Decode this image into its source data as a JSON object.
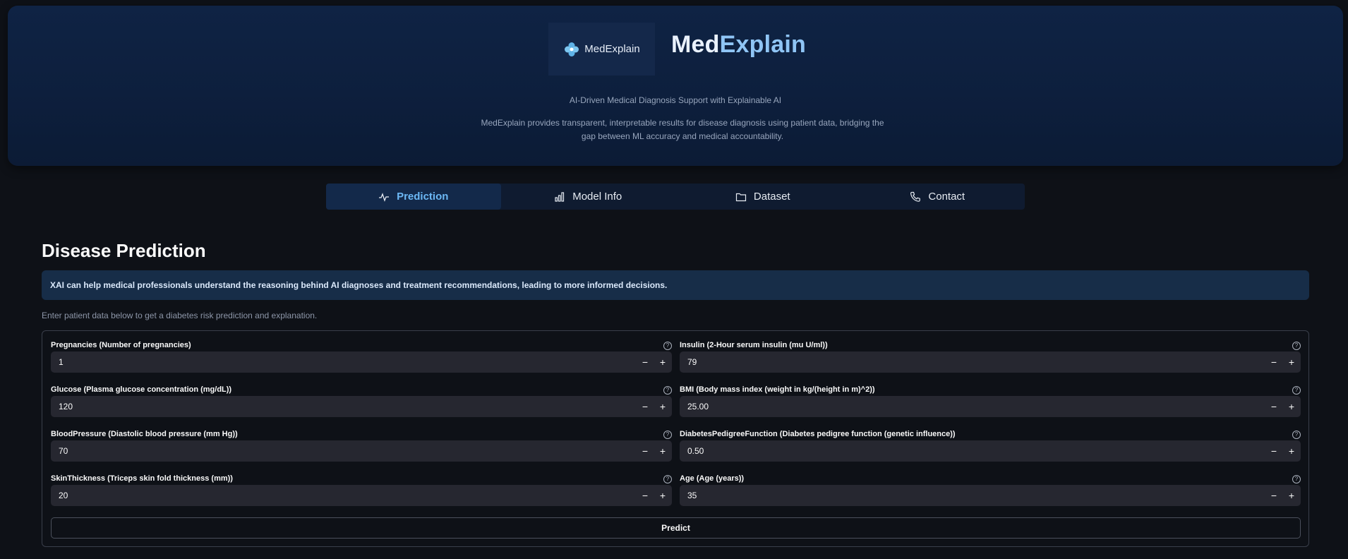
{
  "header": {
    "logo_text": "MedExplain",
    "brand_part1": "Med",
    "brand_part2": "Explain",
    "tagline": "AI-Driven Medical Diagnosis Support with Explainable AI",
    "description": "MedExplain provides transparent, interpretable results for disease diagnosis using patient data, bridging the gap between ML accuracy and medical accountability."
  },
  "tabs": [
    {
      "label": "Prediction",
      "icon": "pulse-icon",
      "active": true
    },
    {
      "label": "Model Info",
      "icon": "bar-chart-icon",
      "active": false
    },
    {
      "label": "Dataset",
      "icon": "folder-icon",
      "active": false
    },
    {
      "label": "Contact",
      "icon": "phone-icon",
      "active": false
    }
  ],
  "main": {
    "title": "Disease Prediction",
    "info": "XAI can help medical professionals understand the reasoning behind AI diagnoses and treatment recommendations, leading to more informed decisions.",
    "hint": "Enter patient data below to get a diabetes risk prediction and explanation.",
    "predict_label": "Predict"
  },
  "fields": [
    {
      "label": "Pregnancies (Number of pregnancies)",
      "value": "1"
    },
    {
      "label": "Insulin (2-Hour serum insulin (mu U/ml))",
      "value": "79"
    },
    {
      "label": "Glucose (Plasma glucose concentration (mg/dL))",
      "value": "120"
    },
    {
      "label": "BMI (Body mass index (weight in kg/(height in m)^2))",
      "value": "25.00"
    },
    {
      "label": "BloodPressure (Diastolic blood pressure (mm Hg))",
      "value": "70"
    },
    {
      "label": "DiabetesPedigreeFunction (Diabetes pedigree function (genetic influence))",
      "value": "0.50"
    },
    {
      "label": "SkinThickness (Triceps skin fold thickness (mm))",
      "value": "20"
    },
    {
      "label": "Age (Age (years))",
      "value": "35"
    }
  ],
  "stepper": {
    "minus": "−",
    "plus": "+",
    "help": "?"
  },
  "colors": {
    "accent": "#6cb8f5",
    "background": "#0e1117",
    "info_bg": "#172d48"
  }
}
